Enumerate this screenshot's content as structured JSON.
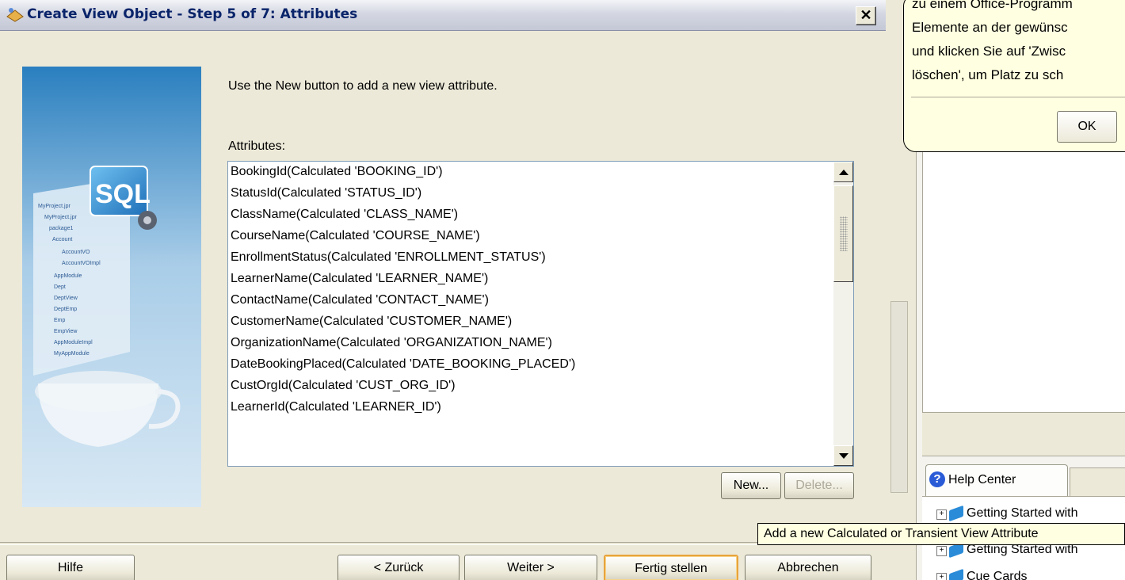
{
  "dialog": {
    "title": "Create View Object - Step 5 of 7: Attributes",
    "instruction": "Use the New button to add a new view attribute.",
    "list_label": "Attributes:",
    "attributes": [
      "BookingId(Calculated 'BOOKING_ID')",
      "StatusId(Calculated 'STATUS_ID')",
      "ClassName(Calculated 'CLASS_NAME')",
      "CourseName(Calculated 'COURSE_NAME')",
      "EnrollmentStatus(Calculated 'ENROLLMENT_STATUS')",
      "LearnerName(Calculated 'LEARNER_NAME')",
      "ContactName(Calculated 'CONTACT_NAME')",
      "CustomerName(Calculated 'CUSTOMER_NAME')",
      "OrganizationName(Calculated 'ORGANIZATION_NAME')",
      "DateBookingPlaced(Calculated 'DATE_BOOKING_PLACED')",
      "CustOrgId(Calculated 'CUST_ORG_ID')",
      "LearnerId(Calculated 'LEARNER_ID')"
    ],
    "new_button": "New...",
    "delete_button": "Delete...",
    "buttons": {
      "help": "Hilfe",
      "back": "< Zurück",
      "next": "Weiter >",
      "finish": "Fertig stellen",
      "cancel": "Abbrechen"
    },
    "graphic_label": "SQL"
  },
  "balloon": {
    "lines": [
      "zu einem Office-Programm",
      "Elemente an der gewünsc",
      "und klicken Sie auf 'Zwisc",
      "löschen', um Platz zu sch"
    ],
    "ok": "OK"
  },
  "help": {
    "tab": "Help Center",
    "tree": [
      "Getting Started with",
      "Getting Started with",
      "Cue Cards"
    ]
  },
  "tooltip": "Add a new Calculated or Transient View Attribute",
  "colors": {
    "title_text": "#0a246a",
    "list_border": "#7f9db9",
    "balloon_bg": "#ffffe1",
    "default_button_border": "#e8a33c"
  }
}
